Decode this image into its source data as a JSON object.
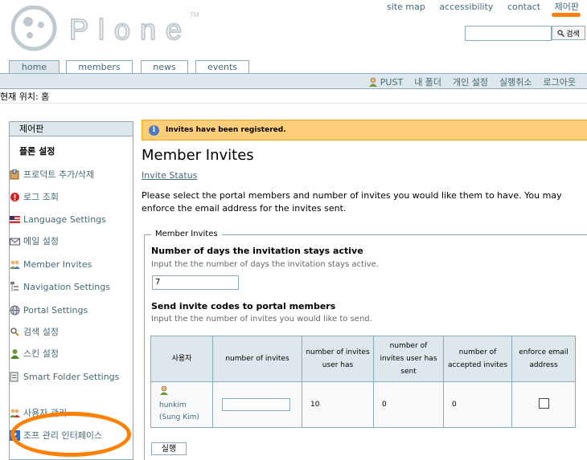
{
  "brand": {
    "name": "Plone",
    "trademark": "TM"
  },
  "site_actions": [
    "site map",
    "accessibility",
    "contact",
    "제어판"
  ],
  "search": {
    "placeholder": "",
    "button_label": "검색"
  },
  "tabs": [
    "home",
    "members",
    "news",
    "events"
  ],
  "personal_bar": {
    "user": "PUST",
    "items": [
      "내 폴더",
      "개인 설정",
      "실행취소",
      "로그아웃"
    ]
  },
  "breadcrumb": "현재 위치: 홈",
  "portlet": {
    "title": "제어판",
    "subheader": "플론 설정",
    "items": [
      "프로덕트 추가/삭제",
      "로그 조회",
      "Language Settings",
      "메일 설정",
      "Member Invites",
      "Navigation Settings",
      "Portal Settings",
      "검색 설정",
      "스킨 설정",
      "Smart Folder Settings",
      "사용자 관리",
      "조프 관리 인터페이스"
    ]
  },
  "status_message": "Invites have been registered.",
  "page_title": "Member Invites",
  "invite_status_link": "Invite Status",
  "description": "Please select the portal members and number of invites you would like them to have. You may enforce the email address for the invites sent.",
  "form": {
    "legend": "Member Invites",
    "days_label": "Number of days the invitation stays active",
    "days_help": "Input the the number of days the invitation stays active.",
    "days_value": "7",
    "invites_label": "Send invite codes to portal members",
    "invites_help": "Input the the number of invites you would like to send.",
    "table": {
      "headers": [
        "사용자",
        "number of invites",
        "number of invites user has",
        "number of invites user has sent",
        "number of accepted invites",
        "enforce email address"
      ],
      "rows": [
        {
          "user_id": "hunkim",
          "user_name": "(Sung Kim)",
          "invites_input": "",
          "has": "10",
          "sent": "0",
          "accepted": "0"
        }
      ]
    },
    "submit_label": "실행"
  },
  "colors": {
    "accent": "#436976",
    "tab_bg": "#dee7ec",
    "status_bg": "#ffce7b",
    "annotation": "#ff7f00"
  }
}
